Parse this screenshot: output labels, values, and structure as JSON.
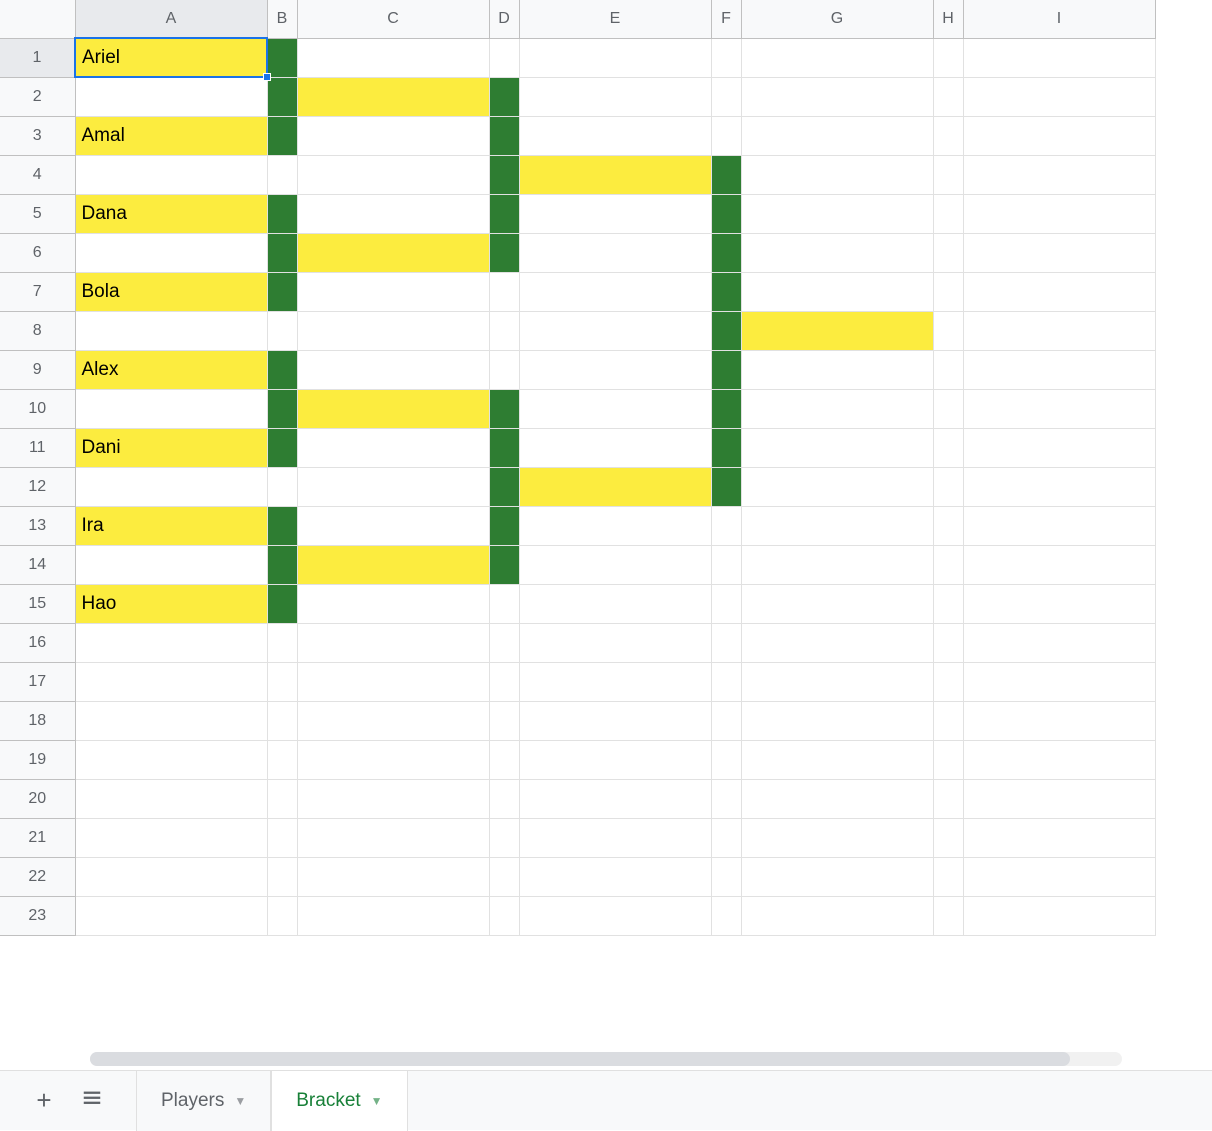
{
  "columns": [
    "A",
    "B",
    "C",
    "D",
    "E",
    "F",
    "G",
    "H",
    "I"
  ],
  "rows": [
    "1",
    "2",
    "3",
    "4",
    "5",
    "6",
    "7",
    "8",
    "9",
    "10",
    "11",
    "12",
    "13",
    "14",
    "15",
    "16",
    "17",
    "18",
    "19",
    "20",
    "21",
    "22",
    "23"
  ],
  "selected_cell": {
    "row": 0,
    "col": 0
  },
  "cells": {
    "A1": {
      "value": "Ariel",
      "bg": "yellow"
    },
    "B1": {
      "value": "",
      "bg": "green"
    },
    "B2": {
      "value": "",
      "bg": "green"
    },
    "C2": {
      "value": "",
      "bg": "yellow"
    },
    "D2": {
      "value": "",
      "bg": "green"
    },
    "A3": {
      "value": "Amal",
      "bg": "yellow"
    },
    "B3": {
      "value": "",
      "bg": "green"
    },
    "D3": {
      "value": "",
      "bg": "green"
    },
    "D4": {
      "value": "",
      "bg": "green"
    },
    "E4": {
      "value": "",
      "bg": "yellow"
    },
    "F4": {
      "value": "",
      "bg": "green"
    },
    "A5": {
      "value": "Dana",
      "bg": "yellow"
    },
    "B5": {
      "value": "",
      "bg": "green"
    },
    "D5": {
      "value": "",
      "bg": "green"
    },
    "F5": {
      "value": "",
      "bg": "green"
    },
    "B6": {
      "value": "",
      "bg": "green"
    },
    "C6": {
      "value": "",
      "bg": "yellow"
    },
    "D6": {
      "value": "",
      "bg": "green"
    },
    "F6": {
      "value": "",
      "bg": "green"
    },
    "A7": {
      "value": "Bola",
      "bg": "yellow"
    },
    "B7": {
      "value": "",
      "bg": "green"
    },
    "F7": {
      "value": "",
      "bg": "green"
    },
    "F8": {
      "value": "",
      "bg": "green"
    },
    "G8": {
      "value": "",
      "bg": "yellow"
    },
    "A9": {
      "value": "Alex",
      "bg": "yellow"
    },
    "B9": {
      "value": "",
      "bg": "green"
    },
    "F9": {
      "value": "",
      "bg": "green"
    },
    "B10": {
      "value": "",
      "bg": "green"
    },
    "C10": {
      "value": "",
      "bg": "yellow"
    },
    "D10": {
      "value": "",
      "bg": "green"
    },
    "F10": {
      "value": "",
      "bg": "green"
    },
    "A11": {
      "value": "Dani",
      "bg": "yellow"
    },
    "B11": {
      "value": "",
      "bg": "green"
    },
    "D11": {
      "value": "",
      "bg": "green"
    },
    "F11": {
      "value": "",
      "bg": "green"
    },
    "D12": {
      "value": "",
      "bg": "green"
    },
    "E12": {
      "value": "",
      "bg": "yellow"
    },
    "F12": {
      "value": "",
      "bg": "green"
    },
    "A13": {
      "value": "Ira",
      "bg": "yellow"
    },
    "B13": {
      "value": "",
      "bg": "green"
    },
    "D13": {
      "value": "",
      "bg": "green"
    },
    "B14": {
      "value": "",
      "bg": "green"
    },
    "C14": {
      "value": "",
      "bg": "yellow"
    },
    "D14": {
      "value": "",
      "bg": "green"
    },
    "A15": {
      "value": "Hao",
      "bg": "yellow"
    },
    "B15": {
      "value": "",
      "bg": "green"
    }
  },
  "tabs": {
    "add_label": "+",
    "items": [
      {
        "label": "Players",
        "active": false
      },
      {
        "label": "Bracket",
        "active": true
      }
    ]
  }
}
